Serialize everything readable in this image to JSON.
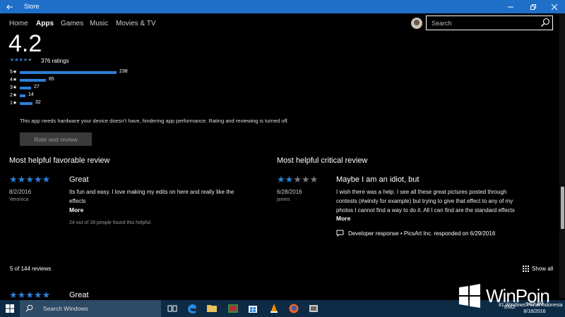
{
  "window": {
    "title": "Store"
  },
  "nav": {
    "tabs": [
      {
        "label": "Home"
      },
      {
        "label": "Apps"
      },
      {
        "label": "Games"
      },
      {
        "label": "Music"
      },
      {
        "label": "Movies & TV"
      }
    ]
  },
  "search": {
    "placeholder": "Search"
  },
  "rating": {
    "average": "4.2",
    "stars_filled": 4,
    "ratings_text": "376 ratings",
    "histogram": [
      {
        "label": "5★",
        "count": "238"
      },
      {
        "label": "4★",
        "count": "65"
      },
      {
        "label": "3★",
        "count": "27"
      },
      {
        "label": "2★",
        "count": "14"
      },
      {
        "label": "1★",
        "count": "32"
      }
    ],
    "hardware_note": "This app needs hardware your device doesn't have, hindering app performance. Rating and reviewing is turned off.",
    "rate_button": "Rate and review"
  },
  "favorable": {
    "heading": "Most helpful favorable review",
    "stars_filled": 5,
    "date": "8/2/2016",
    "author": "Veronica",
    "title": "Great",
    "body_line1": "Its fun and easy. I love making my edits on here and really like the",
    "body_line2": "effects",
    "more": "More",
    "helpful": "24 out of 28 people found this helpful."
  },
  "critical": {
    "heading": "Most helpful critical review",
    "stars_filled": 2,
    "date": "6/28/2016",
    "author": "james",
    "title": "Maybe I am an idiot, but",
    "body_line1": "I wish there was a help. I see all these great pictures posted through",
    "body_line2": "contests (#windy for example) but trying to give that effect to any of my",
    "body_line3": "photos I cannot find a way to do it. All I can find are the standard effects",
    "more": "More",
    "developer_response": "Developer response • PicsArt Inc. responded on 6/29/2016"
  },
  "reviews": {
    "count_text": "5 of 144 reviews",
    "show_all": "Show all",
    "next_stars_filled": 5,
    "next_title": "Great"
  },
  "taskbar": {
    "search_label": "Search Windows",
    "clock_time": "9:07 AM",
    "clock_date": "8/18/2016",
    "lang": "ENG"
  },
  "watermark": {
    "text": "WinPoin",
    "subline": "#1 Windows Portal Indonesia"
  },
  "colors": {
    "accent": "#2b7fd8",
    "titlebar": "#1f6fc9",
    "background": "#000000"
  }
}
